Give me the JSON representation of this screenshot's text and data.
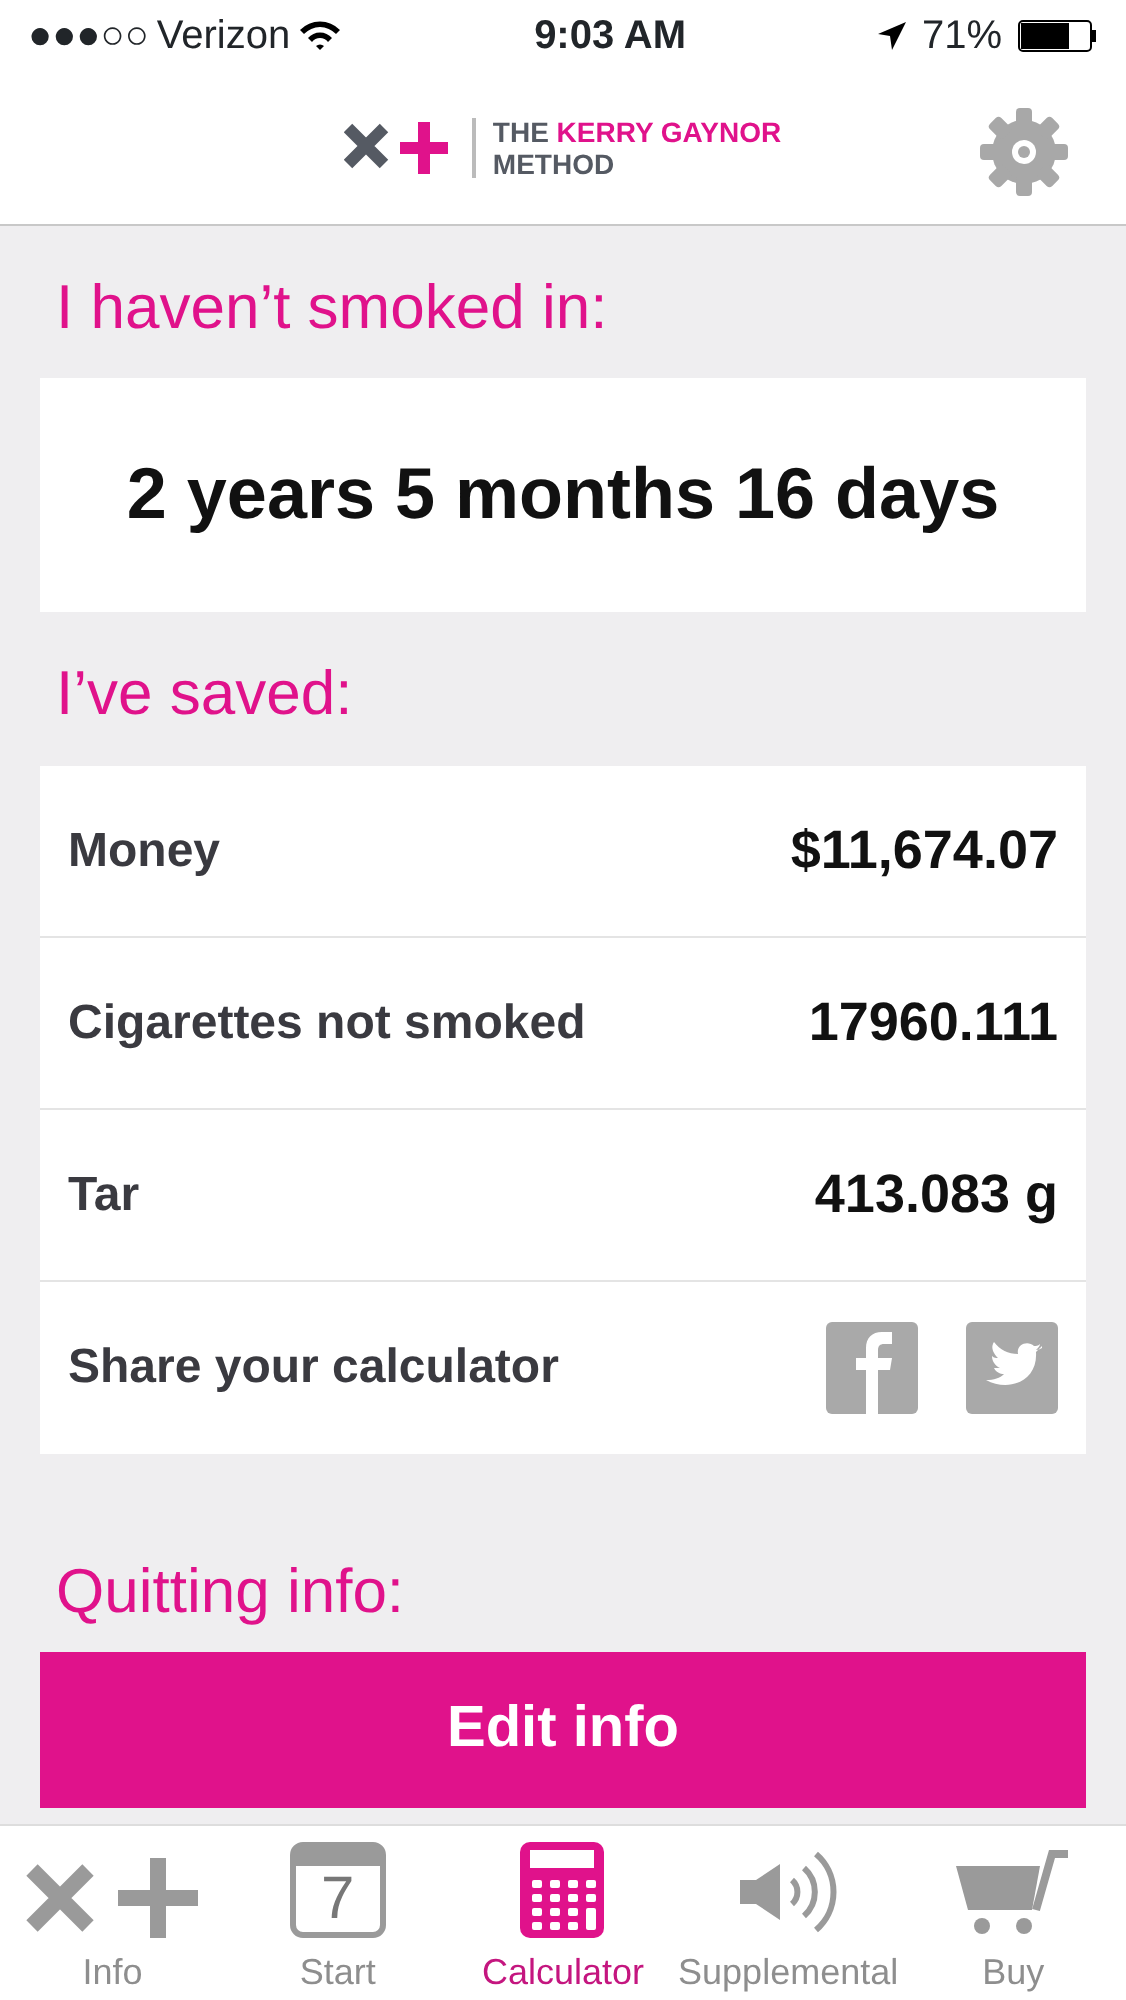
{
  "status_bar": {
    "signal_dots": "●●●○○",
    "carrier": "Verizon",
    "time": "9:03 AM",
    "battery": "71%"
  },
  "header": {
    "logo": {
      "line1_a": "THE",
      "line1_b": "KERRY GAYNOR",
      "line2": "METHOD"
    }
  },
  "smoke_free": {
    "heading": "I haven’t smoked in:",
    "value": "2 years 5 months 16 days"
  },
  "savings": {
    "heading": "I’ve saved:",
    "rows": [
      {
        "kind": "stat",
        "label": "Money",
        "value": "$11,674.07"
      },
      {
        "kind": "stat",
        "label": "Cigarettes not smoked",
        "value": "17960.111"
      },
      {
        "kind": "stat",
        "label": "Tar",
        "value": "413.083 g"
      },
      {
        "kind": "share",
        "label": "Share your calculator"
      }
    ]
  },
  "quitting": {
    "heading": "Quitting info:",
    "button": "Edit info"
  },
  "tabs": [
    {
      "kind": "info",
      "label": "Info",
      "selected": false
    },
    {
      "kind": "start",
      "label": "Start",
      "day": "7",
      "selected": false
    },
    {
      "kind": "calculator",
      "label": "Calculator",
      "selected": true
    },
    {
      "kind": "supplemental",
      "label": "Supplemental",
      "selected": false
    },
    {
      "kind": "buy",
      "label": "Buy",
      "selected": false
    }
  ]
}
